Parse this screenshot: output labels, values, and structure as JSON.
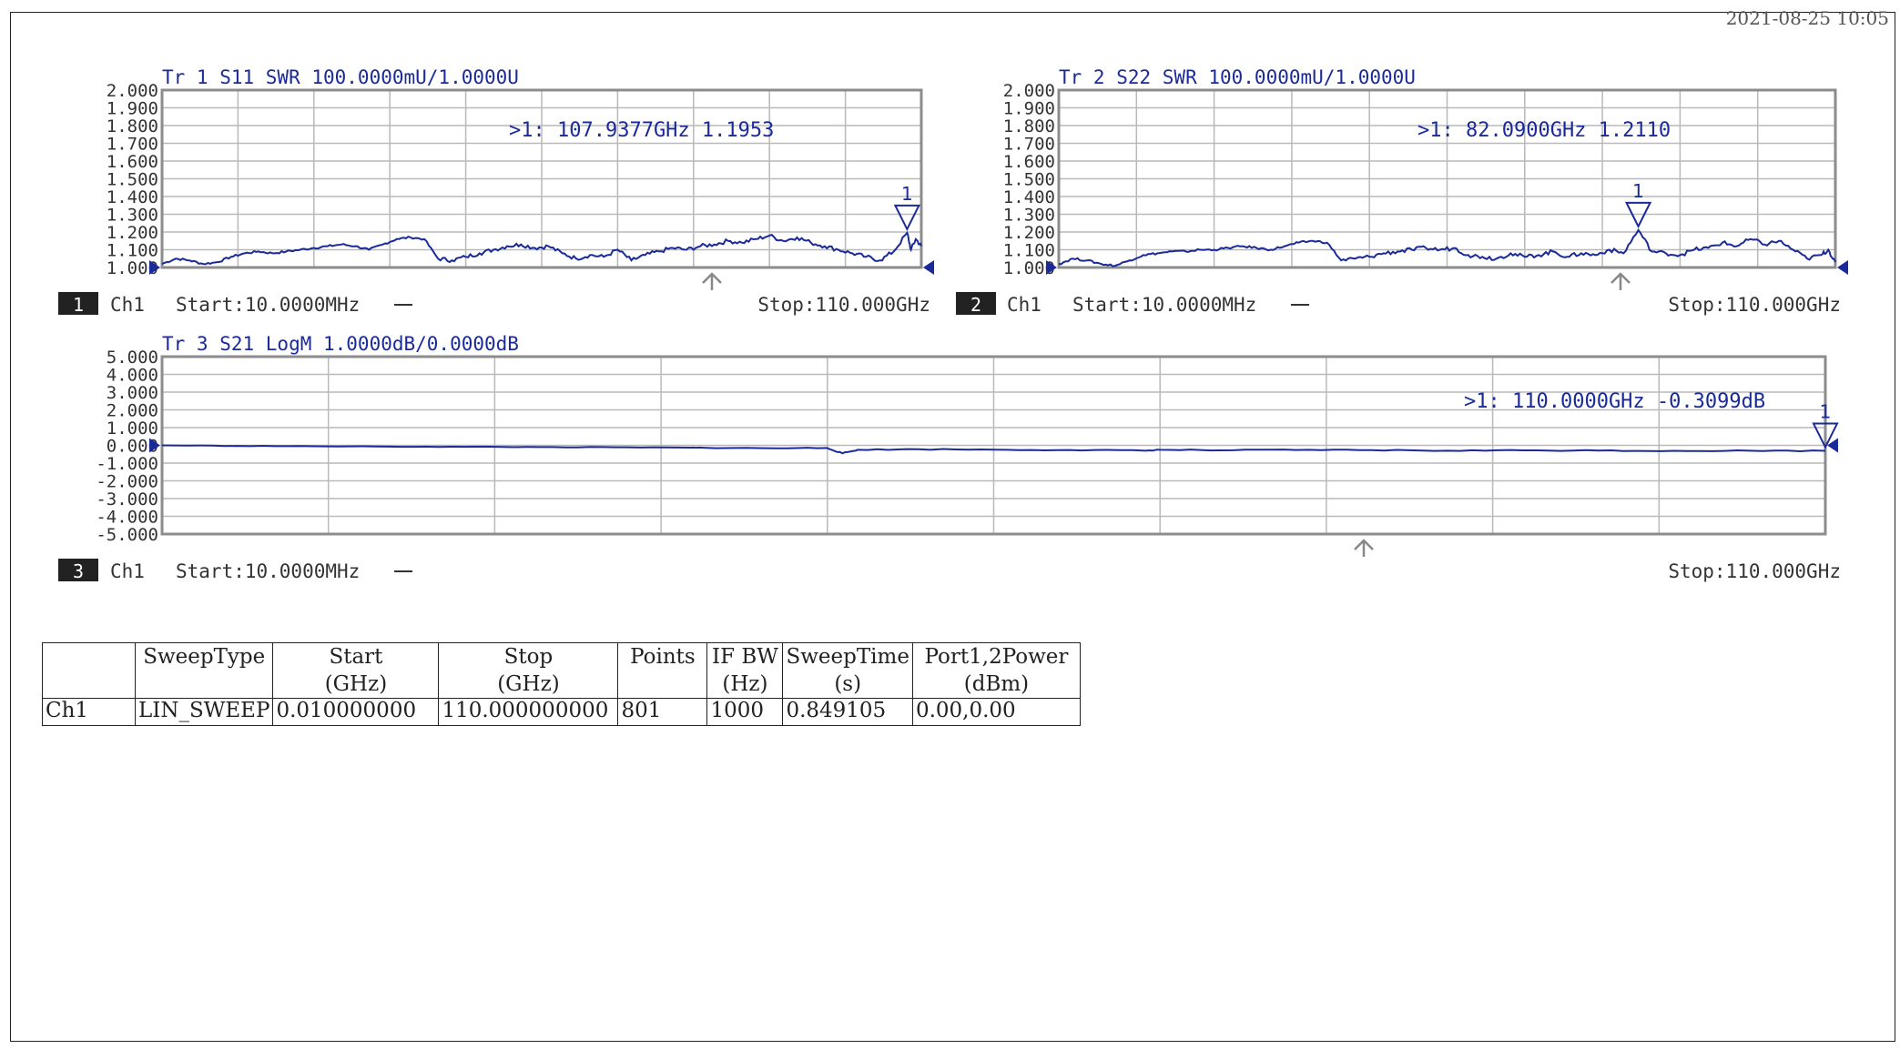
{
  "header": {
    "date_fragment": "2021-08-25 10:05"
  },
  "chart_data": [
    {
      "type": "line",
      "trace": "Tr 1",
      "parameter": "S11",
      "format": "SWR",
      "title": "Tr 1  S11 SWR 100.0000mU/1.0000U",
      "channel_number": "1",
      "channel": "Ch1",
      "start_label": "Start:10.0000MHz",
      "stop_label": "Stop:110.000GHz",
      "x_range_ghz": [
        0.01,
        110
      ],
      "ylim": [
        1.0,
        2.0
      ],
      "yticks": [
        "2.000",
        "1.900",
        "1.800",
        "1.700",
        "1.600",
        "1.500",
        "1.400",
        "1.300",
        "1.200",
        "1.100",
        "1.000"
      ],
      "grid": true,
      "marker": {
        "number": "1",
        "x_ghz": 107.9377,
        "y": 1.1953,
        "readout": ">1:  107.9377GHz 1.1953"
      },
      "series": [
        {
          "x_ghz": [
            0.01,
            2,
            4,
            6,
            8,
            10,
            12,
            14,
            16,
            18,
            20,
            22,
            24,
            26,
            28,
            30,
            32,
            34,
            36,
            38,
            40,
            42,
            44,
            46,
            48,
            50,
            52,
            54,
            56,
            58,
            60,
            62,
            64,
            66,
            68,
            70,
            72,
            74,
            76,
            78,
            80,
            82,
            84,
            86,
            88,
            90,
            92,
            94,
            96,
            98,
            100,
            102,
            104,
            106,
            107.94,
            108.5,
            109.2,
            110
          ],
          "y": [
            1.02,
            1.05,
            1.04,
            1.02,
            1.03,
            1.06,
            1.08,
            1.09,
            1.08,
            1.09,
            1.1,
            1.11,
            1.12,
            1.13,
            1.12,
            1.1,
            1.13,
            1.16,
            1.17,
            1.16,
            1.05,
            1.04,
            1.06,
            1.08,
            1.1,
            1.12,
            1.13,
            1.11,
            1.12,
            1.08,
            1.05,
            1.07,
            1.06,
            1.1,
            1.04,
            1.07,
            1.09,
            1.11,
            1.1,
            1.12,
            1.13,
            1.15,
            1.14,
            1.16,
            1.18,
            1.15,
            1.17,
            1.14,
            1.12,
            1.1,
            1.08,
            1.06,
            1.04,
            1.09,
            1.1953,
            1.1,
            1.16,
            1.12
          ]
        }
      ]
    },
    {
      "type": "line",
      "trace": "Tr 2",
      "parameter": "S22",
      "format": "SWR",
      "title": "Tr 2  S22 SWR 100.0000mU/1.0000U",
      "channel_number": "2",
      "channel": "Ch1",
      "start_label": "Start:10.0000MHz",
      "stop_label": "Stop:110.000GHz",
      "x_range_ghz": [
        0.01,
        110
      ],
      "ylim": [
        1.0,
        2.0
      ],
      "yticks": [
        "2.000",
        "1.900",
        "1.800",
        "1.700",
        "1.600",
        "1.500",
        "1.400",
        "1.300",
        "1.200",
        "1.100",
        "1.000"
      ],
      "grid": true,
      "marker": {
        "number": "1",
        "x_ghz": 82.09,
        "y": 1.211,
        "readout": ">1:   82.0900GHz 1.2110"
      },
      "series": [
        {
          "x_ghz": [
            0.01,
            2,
            4,
            6,
            8,
            10,
            12,
            14,
            16,
            18,
            20,
            22,
            24,
            26,
            28,
            30,
            32,
            34,
            36,
            38,
            40,
            42,
            44,
            46,
            48,
            50,
            52,
            54,
            56,
            58,
            60,
            62,
            64,
            66,
            68,
            70,
            72,
            74,
            76,
            78,
            80,
            82.09,
            84,
            86,
            88,
            90,
            92,
            94,
            96,
            98,
            100,
            102,
            104,
            106,
            108,
            109,
            110
          ],
          "y": [
            1.02,
            1.05,
            1.04,
            1.02,
            1.01,
            1.04,
            1.07,
            1.08,
            1.09,
            1.09,
            1.1,
            1.1,
            1.11,
            1.12,
            1.11,
            1.1,
            1.12,
            1.14,
            1.15,
            1.14,
            1.04,
            1.05,
            1.06,
            1.08,
            1.09,
            1.1,
            1.11,
            1.1,
            1.11,
            1.07,
            1.06,
            1.05,
            1.08,
            1.06,
            1.07,
            1.09,
            1.06,
            1.08,
            1.07,
            1.1,
            1.08,
            1.211,
            1.09,
            1.08,
            1.07,
            1.1,
            1.11,
            1.14,
            1.12,
            1.16,
            1.13,
            1.15,
            1.1,
            1.05,
            1.07,
            1.1,
            1.03
          ]
        }
      ]
    },
    {
      "type": "line",
      "trace": "Tr 3",
      "parameter": "S21",
      "format": "LogM",
      "title": "Tr 3  S21 LogM 1.0000dB/0.0000dB",
      "channel_number": "3",
      "channel": "Ch1",
      "start_label": "Start:10.0000MHz",
      "stop_label": "Stop:110.000GHz",
      "x_range_ghz": [
        0.01,
        110
      ],
      "ylim": [
        -5.0,
        5.0
      ],
      "yticks": [
        "5.000",
        "4.000",
        "3.000",
        "2.000",
        "1.000",
        "0.000",
        "-1.000",
        "-2.000",
        "-3.000",
        "-4.000",
        "-5.000"
      ],
      "grid": true,
      "marker": {
        "number": "1",
        "x_ghz": 110.0,
        "y": -0.3099,
        "readout": ">1:  110.0000GHz -0.3099dB"
      },
      "series": [
        {
          "x_ghz": [
            0.01,
            5,
            10,
            15,
            20,
            25,
            30,
            35,
            36,
            40,
            44,
            45,
            46,
            50,
            55,
            60,
            65,
            66,
            70,
            75,
            80,
            85,
            90,
            95,
            100,
            105,
            110
          ],
          "y": [
            0.0,
            -0.03,
            -0.05,
            -0.07,
            -0.08,
            -0.1,
            -0.11,
            -0.13,
            -0.14,
            -0.16,
            -0.15,
            -0.45,
            -0.25,
            -0.22,
            -0.24,
            -0.26,
            -0.3,
            -0.25,
            -0.28,
            -0.26,
            -0.27,
            -0.3,
            -0.28,
            -0.29,
            -0.31,
            -0.3,
            -0.3099
          ]
        }
      ]
    }
  ],
  "sweep_table": {
    "headers": [
      {
        "line1": "",
        "line2": ""
      },
      {
        "line1": "SweepType",
        "line2": ""
      },
      {
        "line1": "Start",
        "line2": "(GHz)"
      },
      {
        "line1": "Stop",
        "line2": "(GHz)"
      },
      {
        "line1": "Points",
        "line2": ""
      },
      {
        "line1": "IF BW",
        "line2": "(Hz)"
      },
      {
        "line1": "SweepTime",
        "line2": "(s)"
      },
      {
        "line1": "Port1,2Power",
        "line2": "(dBm)"
      }
    ],
    "row": [
      "Ch1",
      "LIN_SWEEP",
      "0.010000000",
      "110.000000000",
      "801",
      "1000",
      "0.849105",
      "0.00,0.00"
    ]
  },
  "colors": {
    "trace": "#1a2a99",
    "grid": "#b9b9b9",
    "frame": "#8c8c8c",
    "badge": "#222222"
  }
}
